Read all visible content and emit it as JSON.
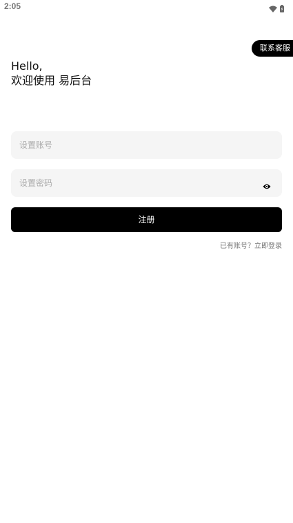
{
  "status_bar": {
    "time": "2:05",
    "wifi_icon": "wifi-icon",
    "battery_icon": "battery-icon"
  },
  "support_button": {
    "label": "联系客服"
  },
  "greeting": {
    "line1": "Hello,",
    "line2": "欢迎使用 易后台"
  },
  "form": {
    "account_placeholder": "设置账号",
    "password_placeholder": "设置密码",
    "password_toggle_icon": "eye-icon",
    "register_label": "注册",
    "login_prompt": "已有账号？立即登录"
  },
  "colors": {
    "primary": "#000000",
    "input_bg": "#f5f5f5",
    "placeholder": "#aaaaaa",
    "muted_text": "#777777"
  }
}
